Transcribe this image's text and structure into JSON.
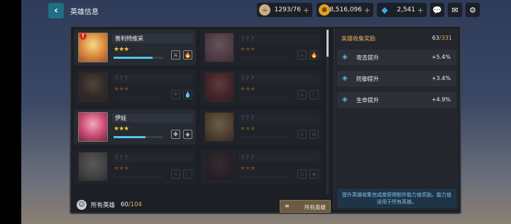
{
  "header": {
    "back_icon": "chevron-left-icon",
    "title": "英雄信息"
  },
  "resources": [
    {
      "name": "stamina",
      "icon": "coffee-cup-icon",
      "value": "1293/76",
      "color": "#c9ad84"
    },
    {
      "name": "gold",
      "icon": "gold-coin-icon",
      "value": "8,516,096",
      "color": "#e2a21f"
    },
    {
      "name": "gems",
      "icon": "diamond-icon",
      "value": "2,541",
      "color": "#39a7e6"
    }
  ],
  "top_buttons": [
    "chat-icon",
    "mail-icon",
    "settings-icon"
  ],
  "heroes": [
    {
      "name": "普利特维采",
      "stars": "★★★",
      "progress": 0.78,
      "locked": false,
      "alert": true,
      "badges": [
        "⚔",
        "🔥"
      ],
      "portrait": [
        "#f7d98a",
        "#d8883a",
        "#a24f3a"
      ]
    },
    {
      "name": "? ? ?",
      "stars": "★★★",
      "progress": 0,
      "locked": true,
      "alert": false,
      "badges": [
        "⚔",
        "🔥"
      ],
      "portrait": [
        "#e7b7b7",
        "#b07080",
        "#704850"
      ]
    },
    {
      "name": "? ? ?",
      "stars": "★★★",
      "progress": 0,
      "locked": true,
      "alert": false,
      "badges": [
        "⛨",
        "💧"
      ],
      "portrait": [
        "#b08a60",
        "#5a3a2a",
        "#3a2a20"
      ]
    },
    {
      "name": "? ? ?",
      "stars": "★★★",
      "progress": 0,
      "locked": true,
      "alert": false,
      "badges": [
        "⚔",
        "☾"
      ],
      "portrait": [
        "#d47070",
        "#8a2a2a",
        "#4a1a1a"
      ]
    },
    {
      "name": "伊娃",
      "stars": "★★★",
      "progress": 0.64,
      "locked": false,
      "alert": false,
      "badges": [
        "✥",
        "◈"
      ],
      "portrait": [
        "#f3a8bc",
        "#c84a72",
        "#6a2a4a"
      ]
    },
    {
      "name": "? ? ?",
      "stars": "★★★",
      "progress": 0,
      "locked": true,
      "alert": false,
      "badges": [
        "⚔",
        "ʍ"
      ],
      "portrait": [
        "#f0d288",
        "#b07a3a",
        "#5a3a2a"
      ]
    },
    {
      "name": "? ? ?",
      "stars": "★★★",
      "progress": 0,
      "locked": true,
      "alert": false,
      "badges": [
        "⚔",
        "☾"
      ],
      "portrait": [
        "#c8c0b8",
        "#8a8078",
        "#4a4240"
      ]
    },
    {
      "name": "? ? ?",
      "stars": "★★★",
      "progress": 0,
      "locked": true,
      "alert": false,
      "badges": [
        "⚔",
        "◈"
      ],
      "portrait": [
        "#6a3a40",
        "#3a2028",
        "#1a1014"
      ]
    }
  ],
  "footer": {
    "label": "所有英雄",
    "count": "60",
    "total": "/104",
    "filter_label": "所有英雄"
  },
  "reward": {
    "title": "英雄收集奖励",
    "count": "63",
    "total": "/331",
    "stats": [
      {
        "label": "攻击提升",
        "value": "+5.4%"
      },
      {
        "label": "防御提升",
        "value": "+3.4%"
      },
      {
        "label": "生命提升",
        "value": "+4.9%"
      }
    ],
    "note": "提升英雄收集完成度获得额外能力值奖励。能力值适用于所有英雄。"
  }
}
